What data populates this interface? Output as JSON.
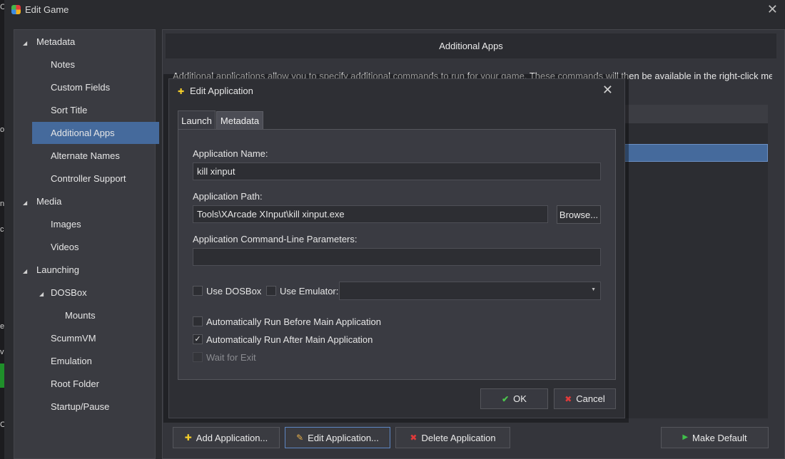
{
  "window": {
    "title": "Edit Game"
  },
  "edge_chars": [
    "C",
    "o",
    "n",
    "c",
    "e",
    "vi",
    "C"
  ],
  "tree": {
    "items": [
      {
        "label": "Metadata",
        "level": 0,
        "expanded": true
      },
      {
        "label": "Notes",
        "level": 1
      },
      {
        "label": "Custom Fields",
        "level": 1
      },
      {
        "label": "Sort Title",
        "level": 1
      },
      {
        "label": "Additional Apps",
        "level": 1,
        "selected": true
      },
      {
        "label": "Alternate Names",
        "level": 1
      },
      {
        "label": "Controller Support",
        "level": 1
      },
      {
        "label": "Media",
        "level": 0,
        "expanded": true
      },
      {
        "label": "Images",
        "level": 1
      },
      {
        "label": "Videos",
        "level": 1
      },
      {
        "label": "Launching",
        "level": 0,
        "expanded": true
      },
      {
        "label": "DOSBox",
        "level": 1,
        "expanded": true
      },
      {
        "label": "Mounts",
        "level": 2
      },
      {
        "label": "ScummVM",
        "level": 1
      },
      {
        "label": "Emulation",
        "level": 1
      },
      {
        "label": "Root Folder",
        "level": 1
      },
      {
        "label": "Startup/Pause",
        "level": 1
      }
    ]
  },
  "pane": {
    "header": "Additional Apps",
    "description": "Additional applications allow you to specify additional commands to run for your game.  These commands will then be available in the right-click menu for"
  },
  "buttons": {
    "add": "Add Application...",
    "edit": "Edit Application...",
    "delete": "Delete Application",
    "make_default": "Make Default"
  },
  "dialog": {
    "title": "Edit Application",
    "tabs": [
      "Launch",
      "Metadata"
    ],
    "app_name_label": "Application Name:",
    "app_name_value": "kill xinput",
    "app_path_label": "Application Path:",
    "app_path_value": "Tools\\XArcade XInput\\kill xinput.exe",
    "browse_label": "Browse...",
    "params_label": "Application Command-Line Parameters:",
    "params_value": "",
    "use_dosbox_label": "Use DOSBox",
    "use_dosbox_checked": false,
    "use_emulator_label": "Use Emulator:",
    "use_emulator_checked": false,
    "emulator_value": "",
    "run_before_label": "Automatically Run Before Main Application",
    "run_before_checked": false,
    "run_after_label": "Automatically Run After Main Application",
    "run_after_checked": true,
    "wait_label": "Wait for Exit",
    "wait_checked": false,
    "ok_label": "OK",
    "cancel_label": "Cancel"
  },
  "colors": {
    "selection": "#456a9c",
    "ok_check": "#4cc34c",
    "cancel_x": "#e03a3a",
    "add_plus": "#f2cc2a",
    "default_arrow": "#3fbf4a"
  }
}
